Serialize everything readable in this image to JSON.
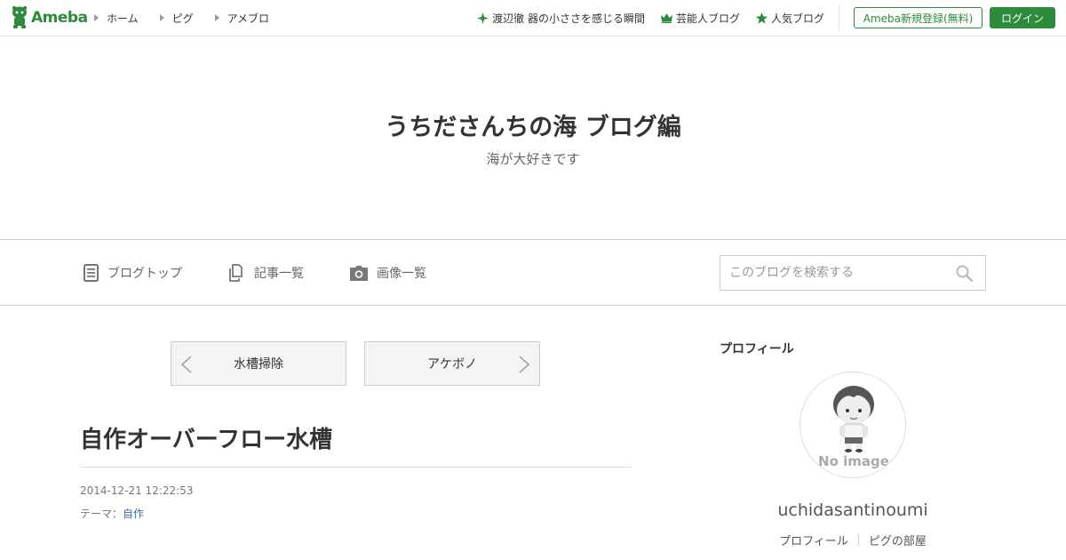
{
  "header": {
    "logo": "Ameba",
    "nav": [
      "ホーム",
      "ピグ",
      "アメブロ"
    ],
    "links": [
      {
        "label": "渡辺徹 器の小ささを感じる瞬間",
        "icon": "sparkle-icon"
      },
      {
        "label": "芸能人ブログ",
        "icon": "crown-icon"
      },
      {
        "label": "人気ブログ",
        "icon": "star-icon"
      }
    ],
    "register_label": "Ameba新規登録(無料)",
    "login_label": "ログイン",
    "accent_color": "#2d8c3c"
  },
  "blog": {
    "title": "うちださんちの海 ブログ編",
    "description": "海が大好きです"
  },
  "blog_nav": {
    "items": [
      {
        "label": "ブログトップ",
        "icon": "document-icon"
      },
      {
        "label": "記事一覧",
        "icon": "copy-icon"
      },
      {
        "label": "画像一覧",
        "icon": "camera-icon"
      }
    ],
    "search_placeholder": "このブログを検索する"
  },
  "pager": {
    "prev_label": "水槽掃除",
    "next_label": "アケボノ"
  },
  "entry": {
    "title": "自作オーバーフロー水槽",
    "date": "2014-12-21 12:22:53",
    "theme_prefix": "テーマ：",
    "theme": "自作"
  },
  "sidebar": {
    "heading": "プロフィール",
    "avatar_text": "No image",
    "username": "uchidasantinoumi",
    "links": [
      "プロフィール",
      "ピグの部屋"
    ]
  }
}
